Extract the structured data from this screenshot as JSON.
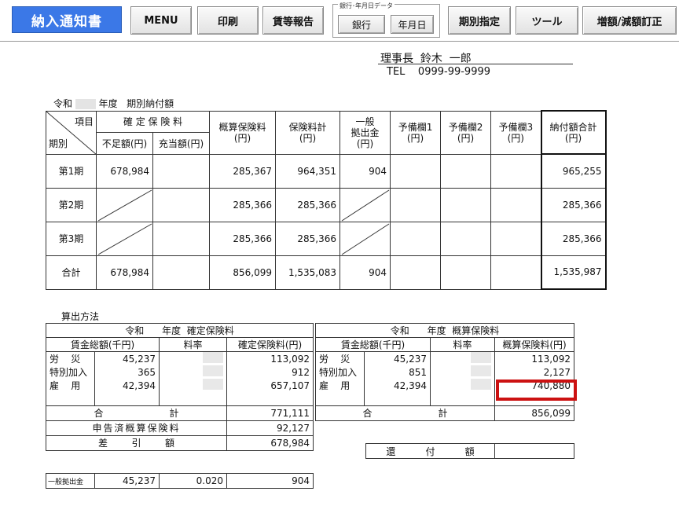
{
  "toolbar": {
    "title": "納入通知書",
    "menu": "MENU",
    "print": "印刷",
    "wage_report": "賃等報告",
    "group_label": "銀行･年月日データ",
    "bank": "銀行",
    "date": "年月日",
    "period": "期別指定",
    "tools": "ツール",
    "correction": "増額/減額訂正"
  },
  "header": {
    "chairman": "理事長  鈴木  一郎",
    "tel": "TEL    0999-99-9999"
  },
  "period_table": {
    "caption_prefix": "令和",
    "caption_suffix": "年度   期別納付額",
    "h_item": "項目",
    "h_period": "期別",
    "h_confirmed": "確 定 保 険 料",
    "h_shortage": "不足額(円)",
    "h_applied": "充当額(円)",
    "h_estimated": "概算保険料\n(円)",
    "h_total_ins": "保険料計\n(円)",
    "h_general": "一般\n拠出金\n(円)",
    "h_res1": "予備欄1\n(円)",
    "h_res2": "予備欄2\n(円)",
    "h_res3": "予備欄3\n(円)",
    "h_paytotal": "納付額合計\n(円)",
    "rows": [
      {
        "label": "第1期",
        "shortage": "678,984",
        "applied": "",
        "estimated": "285,367",
        "total": "964,351",
        "general": "904",
        "pay": "965,255"
      },
      {
        "label": "第2期",
        "shortage": "",
        "applied": "",
        "estimated": "285,366",
        "total": "285,366",
        "general": "",
        "pay": "285,366"
      },
      {
        "label": "第3期",
        "shortage": "",
        "applied": "",
        "estimated": "285,366",
        "total": "285,366",
        "general": "",
        "pay": "285,366"
      },
      {
        "label": "合計",
        "shortage": "678,984",
        "applied": "",
        "estimated": "856,099",
        "total": "1,535,083",
        "general": "904",
        "pay": "1,535,987"
      }
    ]
  },
  "calc": {
    "title": "算出方法",
    "left": {
      "caption": "令和      年度  確定保険料",
      "h_wage": "賃金総額(千円)",
      "h_rate": "料率",
      "h_premium": "確定保険料(円)",
      "rows": [
        {
          "label": "労    災",
          "wage": "45,237",
          "premium": "113,092"
        },
        {
          "label": "特別加入",
          "wage": "365",
          "premium": "912"
        },
        {
          "label": "雇    用",
          "wage": "42,394",
          "premium": "657,107"
        }
      ],
      "sum_label": "合                      計",
      "sum_value": "771,111",
      "declared_label": "申告済概算保険料",
      "declared_value": "92,127",
      "diff_label": "差        引        額",
      "diff_value": "678,984"
    },
    "right": {
      "caption": "令和      年度  概算保険料",
      "h_wage": "賃金総額(千円)",
      "h_rate": "料率",
      "h_premium": "概算保険料(円)",
      "rows": [
        {
          "label": "労    災",
          "wage": "45,237",
          "premium": "113,092"
        },
        {
          "label": "特別加入",
          "wage": "851",
          "premium": "2,127"
        },
        {
          "label": "雇    用",
          "wage": "42,394",
          "premium": "740,880"
        }
      ],
      "sum_label": "合                      計",
      "sum_value": "856,099",
      "refund_label": "還          付          額",
      "refund_value": ""
    },
    "general": {
      "label": "一般拠出金",
      "wage": "45,237",
      "rate": "0.020",
      "amount": "904"
    }
  }
}
